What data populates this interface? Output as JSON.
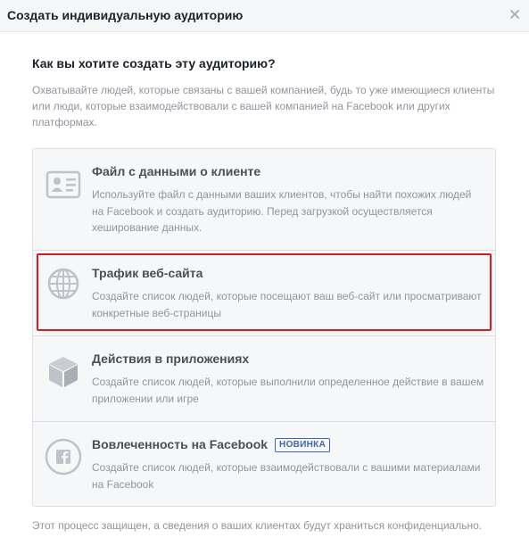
{
  "dialog": {
    "title": "Создать индивидуальную аудиторию",
    "close_label": "×"
  },
  "main": {
    "question": "Как вы хотите создать эту аудиторию?",
    "description": "Охватывайте людей, которые связаны с вашей компанией, будь то уже имеющиеся клиенты или люди, которые взаимодействовали с вашей компанией на Facebook или других платформах."
  },
  "options": [
    {
      "icon": "customer-file-icon",
      "title": "Файл с данными о клиенте",
      "text": "Используйте файл с данными ваших клиентов, чтобы найти похожих людей на Facebook и создать аудиторию. Перед загрузкой осуществляется хеширование данных."
    },
    {
      "icon": "globe-icon",
      "title": "Трафик веб-сайта",
      "text": "Создайте список людей, которые посещают ваш веб-сайт или просматривают конкретные веб-страницы",
      "highlighted": true
    },
    {
      "icon": "cube-icon",
      "title": "Действия в приложениях",
      "text": "Создайте список людей, которые выполнили определенное действие в вашем приложении или игре"
    },
    {
      "icon": "facebook-icon",
      "title": "Вовлеченность на Facebook",
      "badge": "НОВИНКА",
      "text": "Создайте список людей, которые взаимодействовали с вашими материалами на Facebook"
    }
  ],
  "footer": {
    "text": "Этот процесс защищен, а сведения о ваших клиентах будут храниться конфиденциально."
  },
  "colors": {
    "header_bg": "#f5f6f7",
    "panel_bg": "#f6f7f9",
    "icon_gray": "#bec2c9",
    "badge_blue": "#4267b2",
    "highlight_red": "#e0191f"
  }
}
